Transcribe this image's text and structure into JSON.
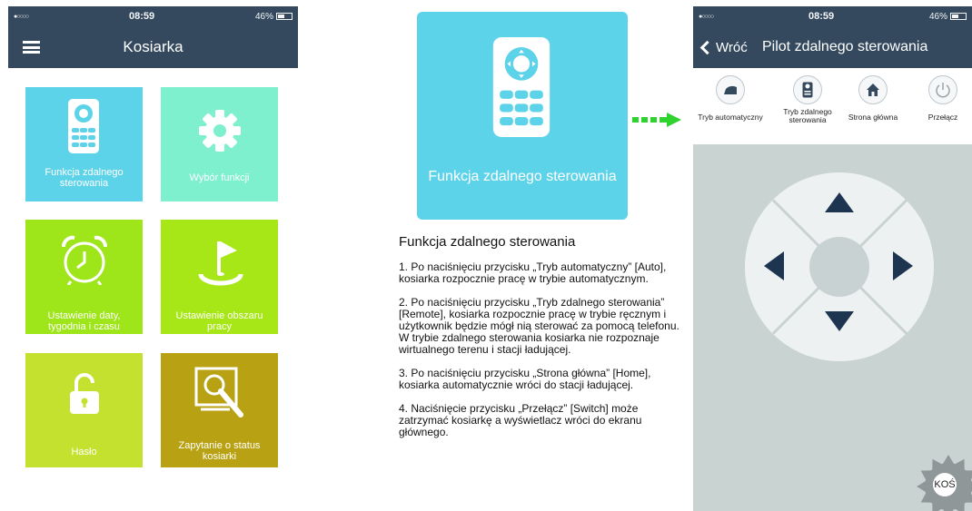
{
  "status": {
    "signal": "●○○○○",
    "time": "08:59",
    "battery": "46%"
  },
  "left_app": {
    "title": "Kosiarka",
    "tiles": [
      {
        "label": "Funkcja zdalnego sterowania",
        "color": "#5dd3ea",
        "icon": "remote-control-icon"
      },
      {
        "label": "Wybór funkcji",
        "color": "#7ef0cd",
        "icon": "gear-icon"
      },
      {
        "label": "Ustawienie daty, tygodnia i czasu",
        "color": "#9ee51a",
        "icon": "alarm-clock-icon"
      },
      {
        "label": "Ustawienie obszaru pracy",
        "color": "#a7e717",
        "icon": "golf-flag-icon"
      },
      {
        "label": "Hasło",
        "color": "#c4e130",
        "icon": "unlocked-padlock-icon"
      },
      {
        "label": "Zapytanie o status kosiarki",
        "color": "#b8a213",
        "icon": "document-search-icon"
      }
    ]
  },
  "middle": {
    "tile_label": "Funkcja zdalnego sterowania",
    "heading": "Funkcja zdalnego sterowania",
    "paragraphs": [
      "1. Po naciśnięciu przycisku „Tryb automatyczny” [Auto], kosiarka rozpocznie pracę w trybie automatycznym.",
      "2. Po naciśnięciu przycisku „Tryb zdalnego sterowania” [Remote], kosiarka rozpocznie pracę w trybie ręcznym i użytkownik będzie mógł nią sterować za pomocą telefonu.\nW trybie zdalnego sterowania kosiarka nie rozpoznaje wirtualnego terenu i stacji ładującej.",
      "3. Po naciśnięciu przycisku „Strona główna” [Home], kosiarka automatycznie wróci do stacji ładującej.",
      "4. Naciśnięcie przycisku „Przełącz” [Switch] może zatrzymać kosiarkę a wyświetlacz wróci do ekranu głównego."
    ]
  },
  "right_app": {
    "back_label": "Wróć",
    "title": "Pilot zdalnego sterowania",
    "modes": [
      {
        "label": "Tryb automatyczny",
        "icon": "auto-mode-icon"
      },
      {
        "label": "Tryb zdalnego sterowania",
        "icon": "remote-mode-icon"
      },
      {
        "label": "Strona główna",
        "icon": "home-icon"
      },
      {
        "label": "Przełącz",
        "icon": "power-icon"
      }
    ],
    "fab_label": "KOŚ"
  },
  "colors": {
    "navbar": "#34495e",
    "arrow": "#2fd32f",
    "pad_arrow": "#1e3552"
  }
}
